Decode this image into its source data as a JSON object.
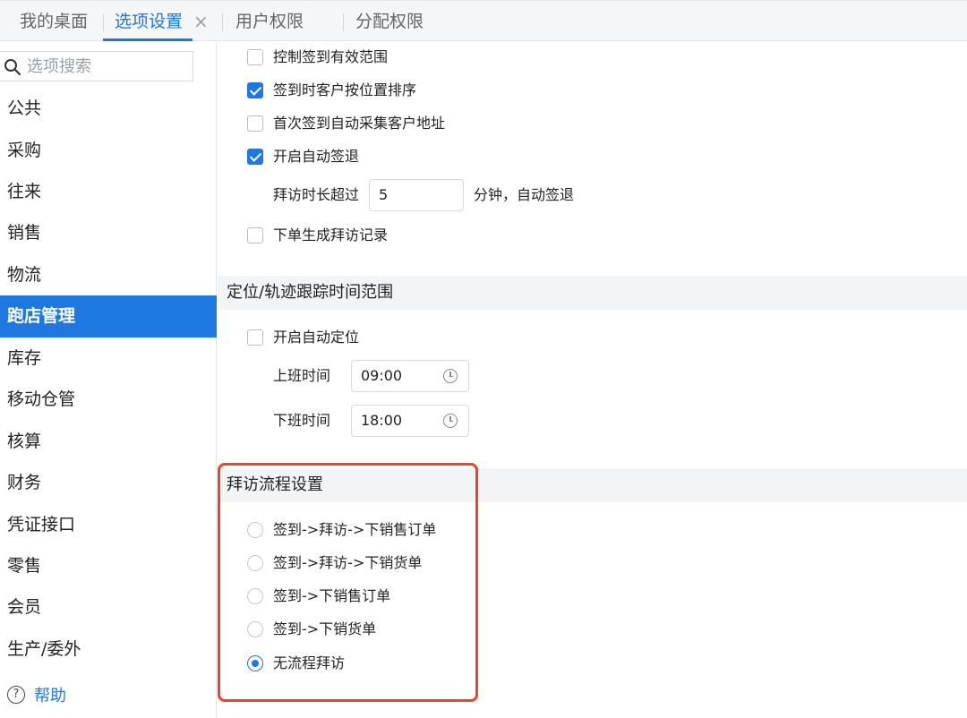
{
  "tabs": [
    {
      "label": "我的桌面"
    },
    {
      "label": "选项设置"
    },
    {
      "label": "用户权限"
    },
    {
      "label": "分配权限"
    }
  ],
  "tab_close_glyph": "×",
  "sidebar": {
    "search_placeholder": "选项搜索",
    "items": [
      {
        "label": "公共"
      },
      {
        "label": "采购"
      },
      {
        "label": "往来"
      },
      {
        "label": "销售"
      },
      {
        "label": "物流"
      },
      {
        "label": "跑店管理"
      },
      {
        "label": "库存"
      },
      {
        "label": "移动仓管"
      },
      {
        "label": "核算"
      },
      {
        "label": "财务"
      },
      {
        "label": "凭证接口"
      },
      {
        "label": "零售"
      },
      {
        "label": "会员"
      },
      {
        "label": "生产/委外"
      }
    ],
    "active_item": "跑店管理",
    "help_label": "帮助",
    "help_glyph": "?"
  },
  "signin": {
    "options": [
      {
        "label": "控制签到有效范围",
        "checked": false
      },
      {
        "label": "签到时客户按位置排序",
        "checked": true
      },
      {
        "label": "首次签到自动采集客户地址",
        "checked": false
      },
      {
        "label": "开启自动签退",
        "checked": true
      }
    ],
    "visit_duration_label": "拜访时长超过",
    "visit_duration_value": "5",
    "visit_duration_unit": "分钟，自动签退",
    "order_record": {
      "label": "下单生成拜访记录",
      "checked": false
    }
  },
  "location_section": {
    "title": "定位/轨迹跟踪时间范围",
    "auto_locate": {
      "label": "开启自动定位",
      "checked": false
    },
    "work_start_label": "上班时间",
    "work_start_value": "09:00",
    "work_end_label": "下班时间",
    "work_end_value": "18:00"
  },
  "visit_flow_section": {
    "title": "拜访流程设置",
    "options": [
      {
        "label": "签到->拜访->下销售订单",
        "selected": false
      },
      {
        "label": "签到->拜访->下销货单",
        "selected": false
      },
      {
        "label": "签到->下销售订单",
        "selected": false
      },
      {
        "label": "签到->下销货单",
        "selected": false
      },
      {
        "label": "无流程拜访",
        "selected": true
      }
    ]
  },
  "colors": {
    "accent": "#1e78e0",
    "highlight_border": "#e8452c"
  }
}
